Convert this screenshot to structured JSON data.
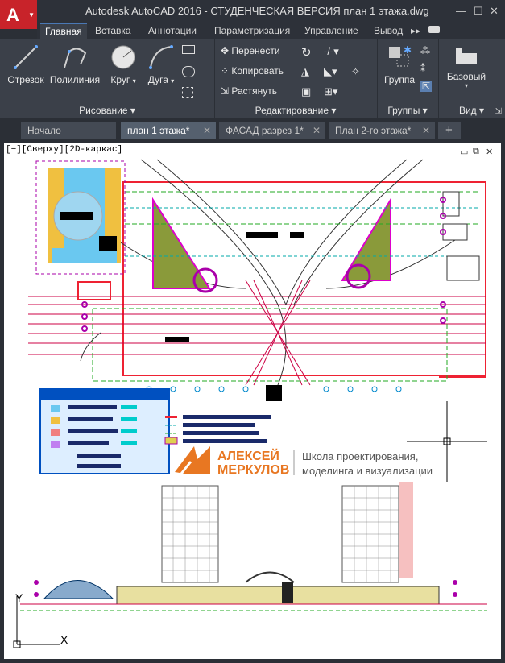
{
  "window": {
    "title": "Autodesk AutoCAD 2016 - СТУДЕНЧЕСКАЯ ВЕРСИЯ    план 1 этажа.dwg",
    "app_letter": "A",
    "minimize": "—",
    "maximize": "☐",
    "close": "✕"
  },
  "ribbon_tabs": [
    "Главная",
    "Вставка",
    "Аннотации",
    "Параметризация",
    "Управление",
    "Вывод"
  ],
  "ribbon_more": "▸▸",
  "draw_panel": {
    "tools": [
      "Отрезок",
      "Полилиния",
      "Круг",
      "Дуга"
    ],
    "label": "Рисование ▾"
  },
  "modify_panel": {
    "items": [
      "Перенести",
      "Копировать",
      "Растянуть"
    ],
    "label": "Редактирование ▾"
  },
  "groups_panel": {
    "tool": "Группа",
    "label": "Группы ▾"
  },
  "view_panel": {
    "tool": "Базовый",
    "label": "Вид ▾"
  },
  "doc_tabs": [
    {
      "label": "Начало",
      "active": false
    },
    {
      "label": "план 1 этажа*",
      "active": true
    },
    {
      "label": "ФАСАД разрез 1*",
      "active": false
    },
    {
      "label": "План 2-го этажа*",
      "active": false
    }
  ],
  "add_tab": "+",
  "viewport": {
    "label": "[−][Сверху][2D-каркас]"
  },
  "watermark": {
    "name_line1": "АЛЕКСЕЙ",
    "name_line2": "МЕРКУЛОВ",
    "tagline_line1": "Школа проектирования,",
    "tagline_line2": "моделинга и визуализации"
  },
  "ucs": {
    "x": "X",
    "y": "Y"
  },
  "colors": {
    "accent": "#c8232a",
    "ribbon_bg": "#3b4049",
    "logo": "#e87722"
  }
}
